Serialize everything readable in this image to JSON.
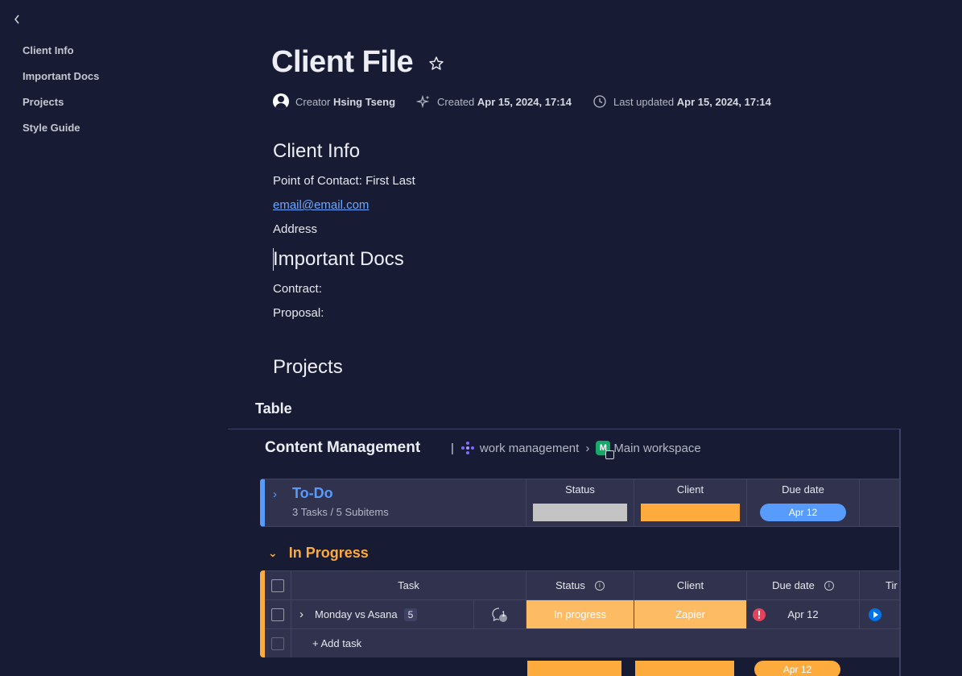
{
  "nav": {
    "back_icon": "chevron-left-icon",
    "toc": [
      "Client Info",
      "Important Docs",
      "Projects",
      "Style Guide"
    ]
  },
  "doc": {
    "title": "Client File",
    "meta": {
      "creator_label": "Creator",
      "creator_name": "Hsing Tseng",
      "created_label": "Created",
      "created_value": "Apr 15, 2024, 17:14",
      "updated_label": "Last updated",
      "updated_value": "Apr 15, 2024, 17:14"
    },
    "sections": {
      "client_info_heading": "Client Info",
      "point_of_contact": "Point of Contact: First Last",
      "email": "email@email.com",
      "address": "Address",
      "important_docs_heading": "Important Docs",
      "contract": "Contract:",
      "proposal": "Proposal:",
      "projects_heading": "Projects",
      "table_label": "Table"
    }
  },
  "board": {
    "title": "Content Management",
    "product": "work management",
    "workspace_badge": "M",
    "workspace": "Main workspace",
    "todo_group": {
      "name": "To-Do",
      "count": "3 Tasks / 5 Subitems",
      "columns": [
        "Status",
        "Client",
        "Due date"
      ],
      "due": "Apr 12"
    },
    "inprogress_group": {
      "name": "In Progress",
      "columns": [
        "Task",
        "Status",
        "Client",
        "Due date",
        "Tir"
      ],
      "rows": [
        {
          "task": "Monday vs Asana",
          "subitems": "5",
          "updates": "1",
          "status": "In progress",
          "client": "Zapier",
          "due": "Apr 12"
        }
      ],
      "add_task": "+ Add task",
      "summary_due": "Apr 12"
    }
  },
  "colors": {
    "bg": "#181b34",
    "todo_blue": "#579bfc",
    "inprogress_orange": "#fdab3d",
    "status_orange": "#fdbc64",
    "grey": "#c4c4c4",
    "overdue_red": "#e2445c"
  }
}
